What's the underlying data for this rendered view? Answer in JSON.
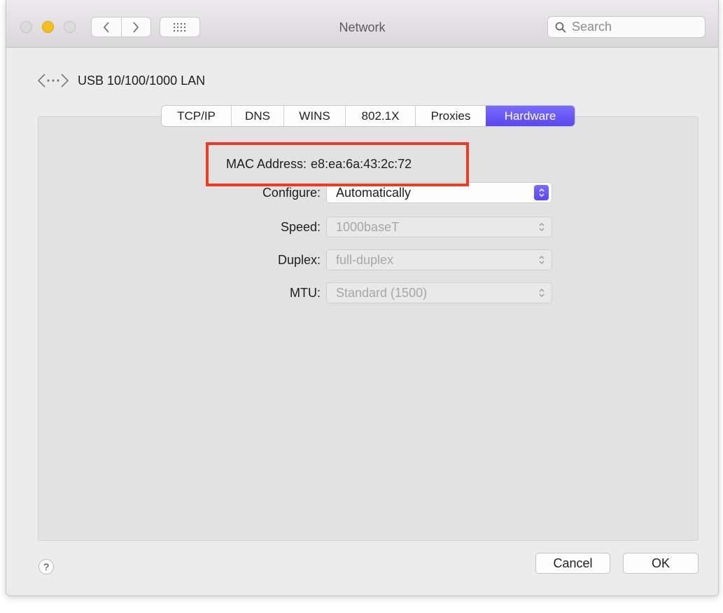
{
  "window": {
    "title": "Network"
  },
  "search": {
    "placeholder": "Search"
  },
  "interface": {
    "name": "USB 10/100/1000 LAN",
    "icon": "network-interface-icon"
  },
  "tabs": [
    {
      "label": "TCP/IP",
      "active": false
    },
    {
      "label": "DNS",
      "active": false
    },
    {
      "label": "WINS",
      "active": false
    },
    {
      "label": "802.1X",
      "active": false
    },
    {
      "label": "Proxies",
      "active": false
    },
    {
      "label": "Hardware",
      "active": true
    }
  ],
  "hardware": {
    "mac_label": "MAC Address:",
    "mac_value": "e8:ea:6a:43:2c:72",
    "configure": {
      "label": "Configure:",
      "value": "Automatically"
    },
    "speed": {
      "label": "Speed:",
      "value": "1000baseT"
    },
    "duplex": {
      "label": "Duplex:",
      "value": "full-duplex"
    },
    "mtu": {
      "label": "MTU:",
      "value": "Standard (1500)"
    }
  },
  "footer": {
    "help_label": "?",
    "cancel_label": "Cancel",
    "ok_label": "OK"
  },
  "colors": {
    "accent": "#5a47f0",
    "highlight": "#ef3b22",
    "minimize": "#f5bf1a"
  }
}
